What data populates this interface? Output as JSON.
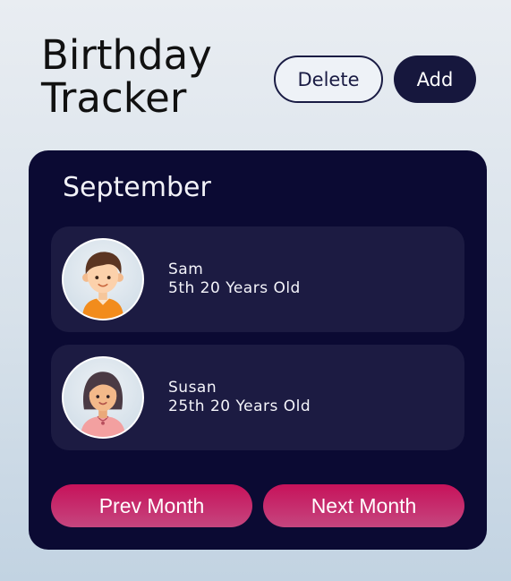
{
  "header": {
    "title_line1": "Birthday",
    "title_line2": "Tracker",
    "delete_label": "Delete",
    "add_label": "Add"
  },
  "card": {
    "month": "September",
    "entries": [
      {
        "name": "Sam",
        "detail": "5th 20 Years Old",
        "avatar": "boy-avatar-icon"
      },
      {
        "name": "Susan",
        "detail": "25th 20 Years Old",
        "avatar": "girl-avatar-icon"
      }
    ],
    "prev_label": "Prev Month",
    "next_label": "Next Month"
  },
  "colors": {
    "card_bg": "#0b0a33",
    "entry_bg": "#1c1b42",
    "accent": "#c7125a",
    "dark_button": "#16173d"
  }
}
